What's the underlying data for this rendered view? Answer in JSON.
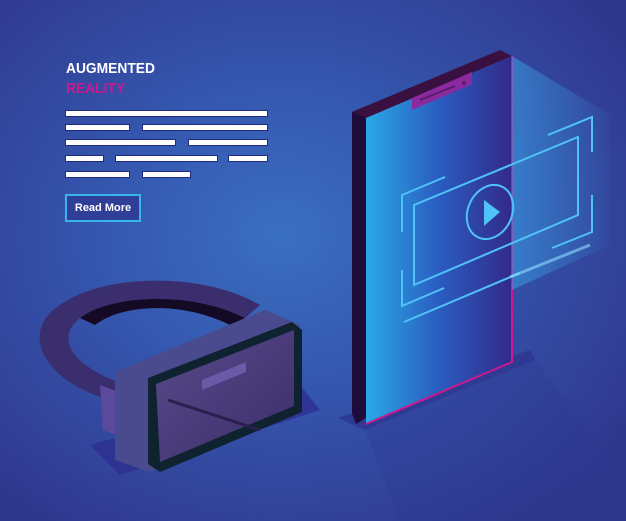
{
  "heading": {
    "line1": "AUGMENTED",
    "line2": "REALITY"
  },
  "colors": {
    "background": "#3348a0",
    "title_primary": "#ffffff",
    "title_accent": "#c8198e",
    "button_border": "#35b6ec",
    "hologram": "#4fc3f7"
  },
  "button": {
    "label": "Read More"
  },
  "illustration": {
    "phone_screen_icon": "play-icon",
    "headset": "vr-headset"
  }
}
